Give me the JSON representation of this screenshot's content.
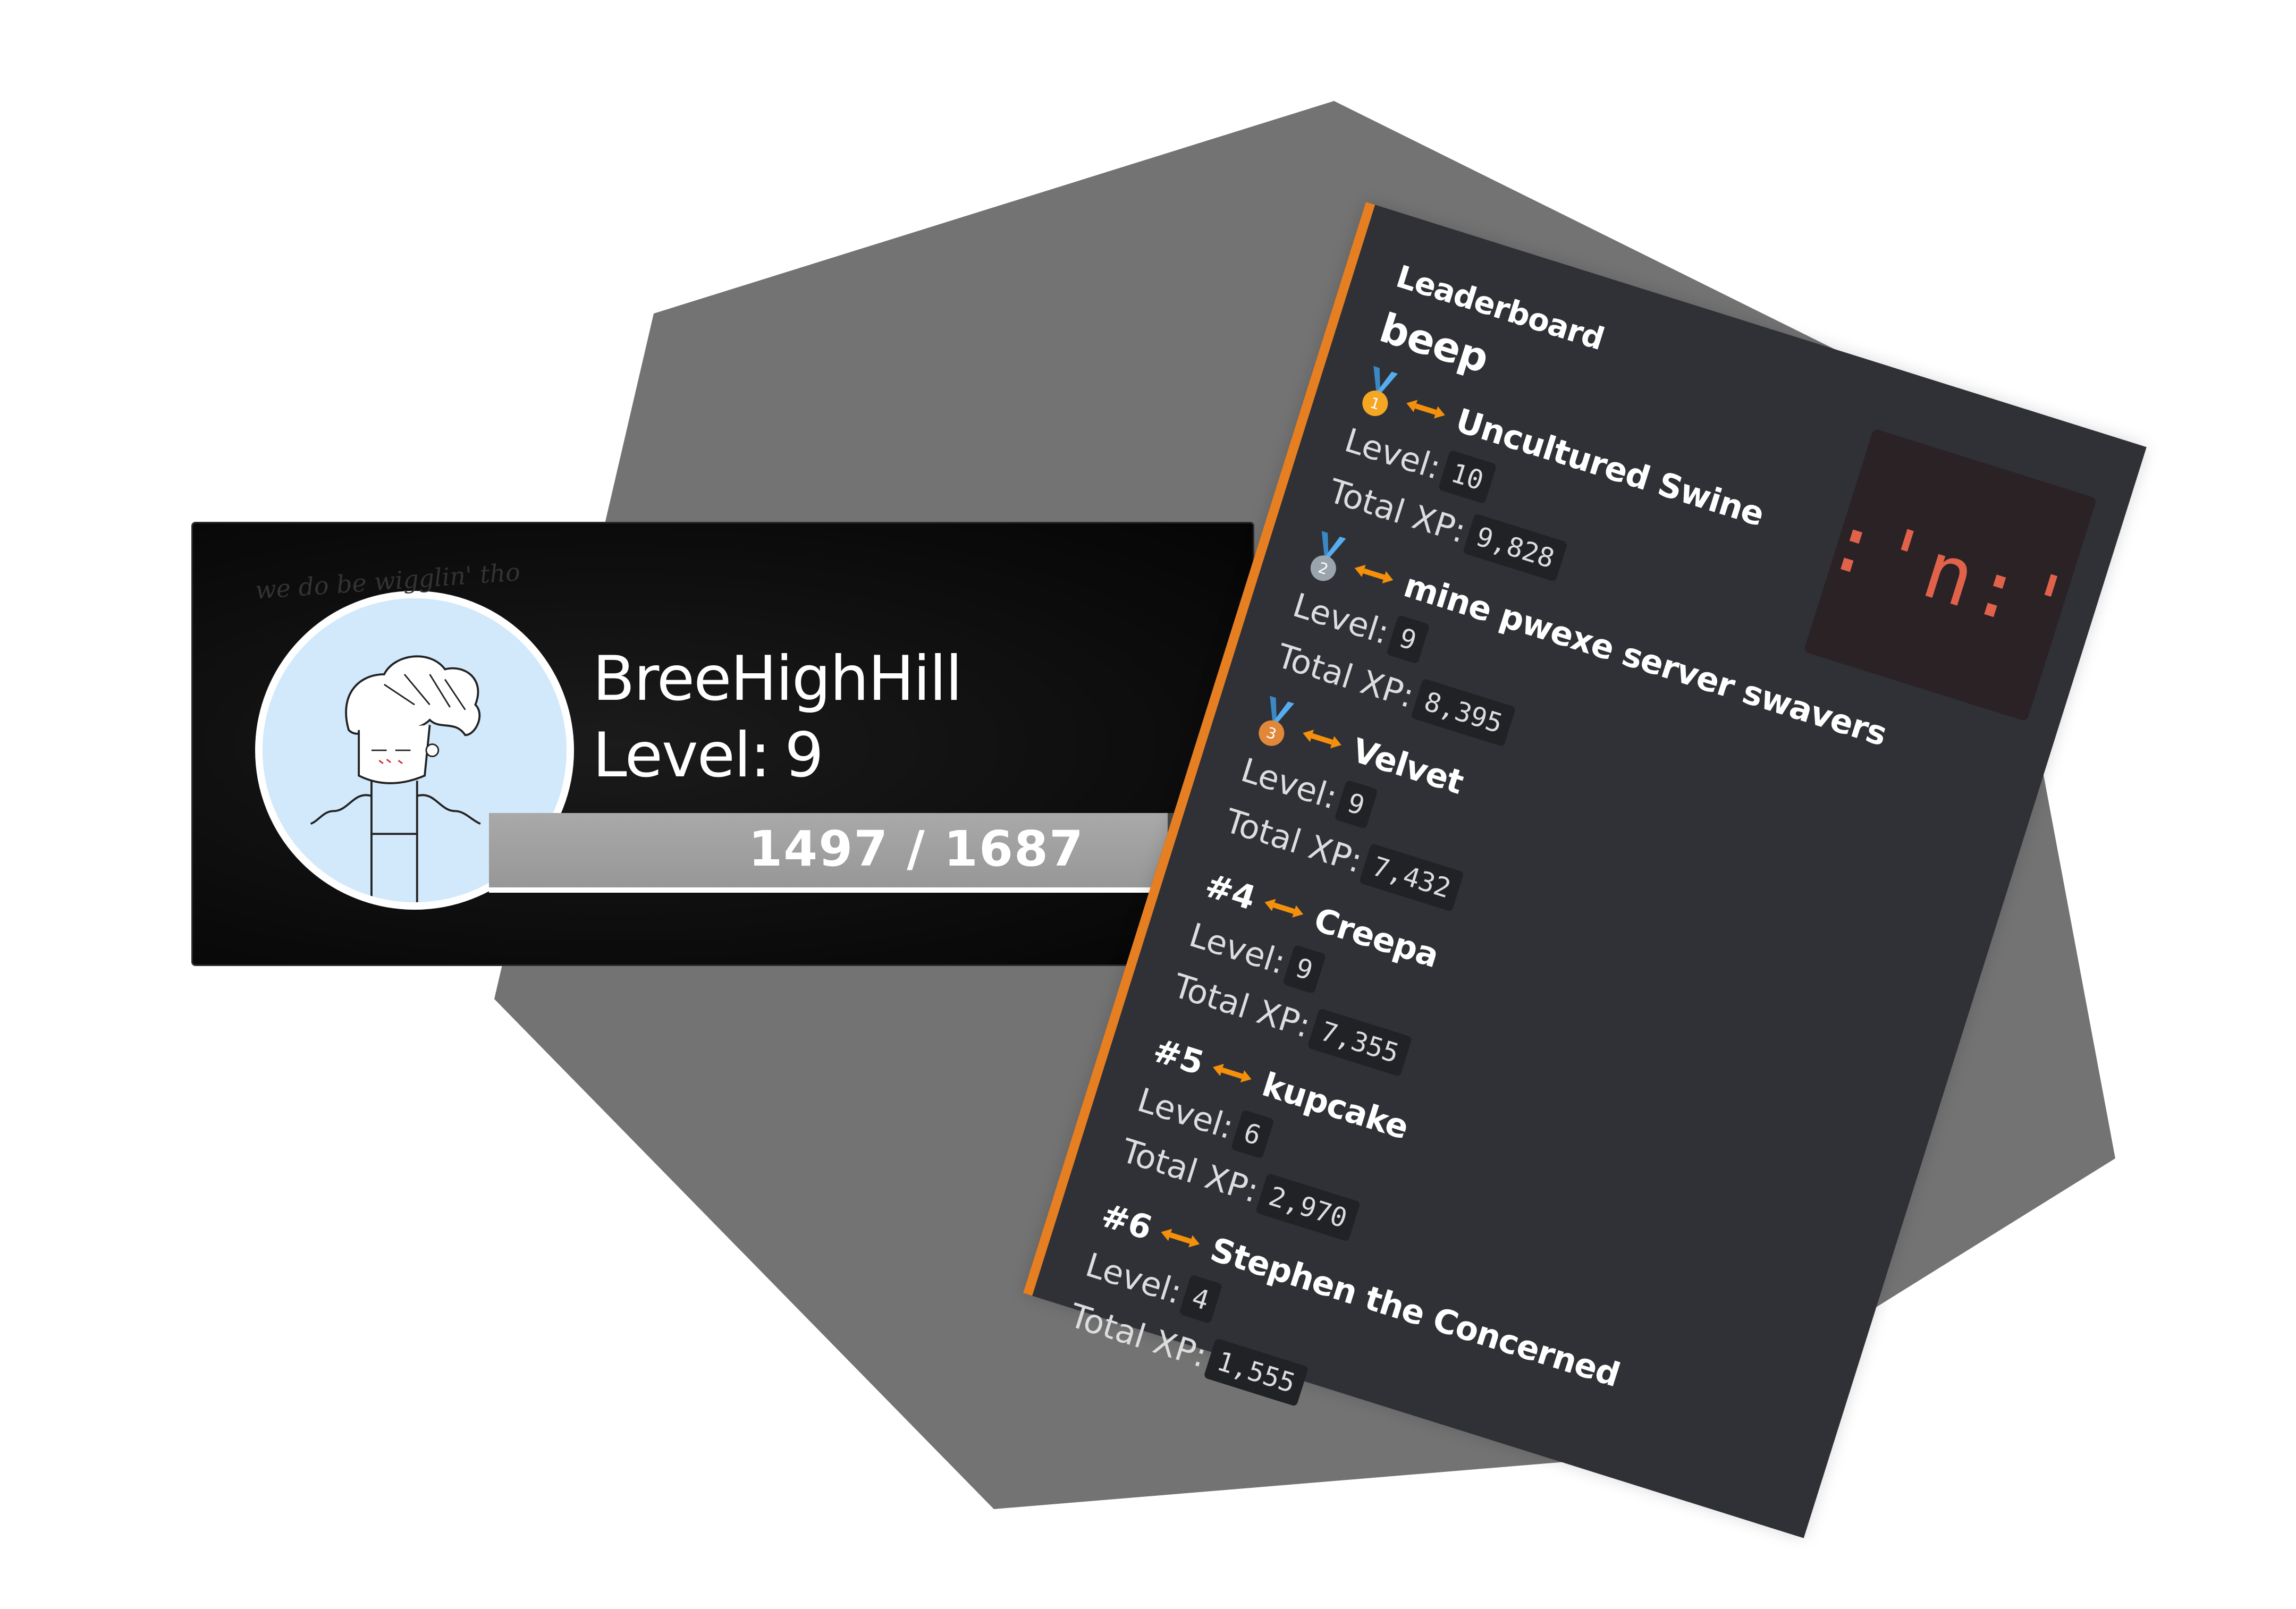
{
  "rank_card": {
    "avatar_caption": "we do be wigglin' tho",
    "username": "BreeHighHill",
    "level_label": "Level:",
    "level_value": "9",
    "xp_text": "1497 / 1687",
    "xp_progress": 0.887
  },
  "leaderboard": {
    "author": "Leaderboard",
    "title": "beep",
    "thumbnail_text": ":'n:'",
    "level_label": "Level:",
    "xp_label": "Total XP:",
    "accent_color": "#e67e22",
    "entries": [
      {
        "rank": "",
        "medal": "gold",
        "name": "Uncultured Swine",
        "level": "10",
        "xp": "9,828"
      },
      {
        "rank": "",
        "medal": "silver",
        "name": "mine pwexe server swavers",
        "level": "9",
        "xp": "8,395"
      },
      {
        "rank": "",
        "medal": "bronze",
        "name": "Velvet",
        "level": "9",
        "xp": "7,432"
      },
      {
        "rank": "#4",
        "medal": "",
        "name": "Creepa",
        "level": "9",
        "xp": "7,355"
      },
      {
        "rank": "#5",
        "medal": "",
        "name": "kupcake",
        "level": "6",
        "xp": "2,970"
      },
      {
        "rank": "#6",
        "medal": "",
        "name": "Stephen the Concerned",
        "level": "4",
        "xp": "1,555"
      }
    ]
  }
}
